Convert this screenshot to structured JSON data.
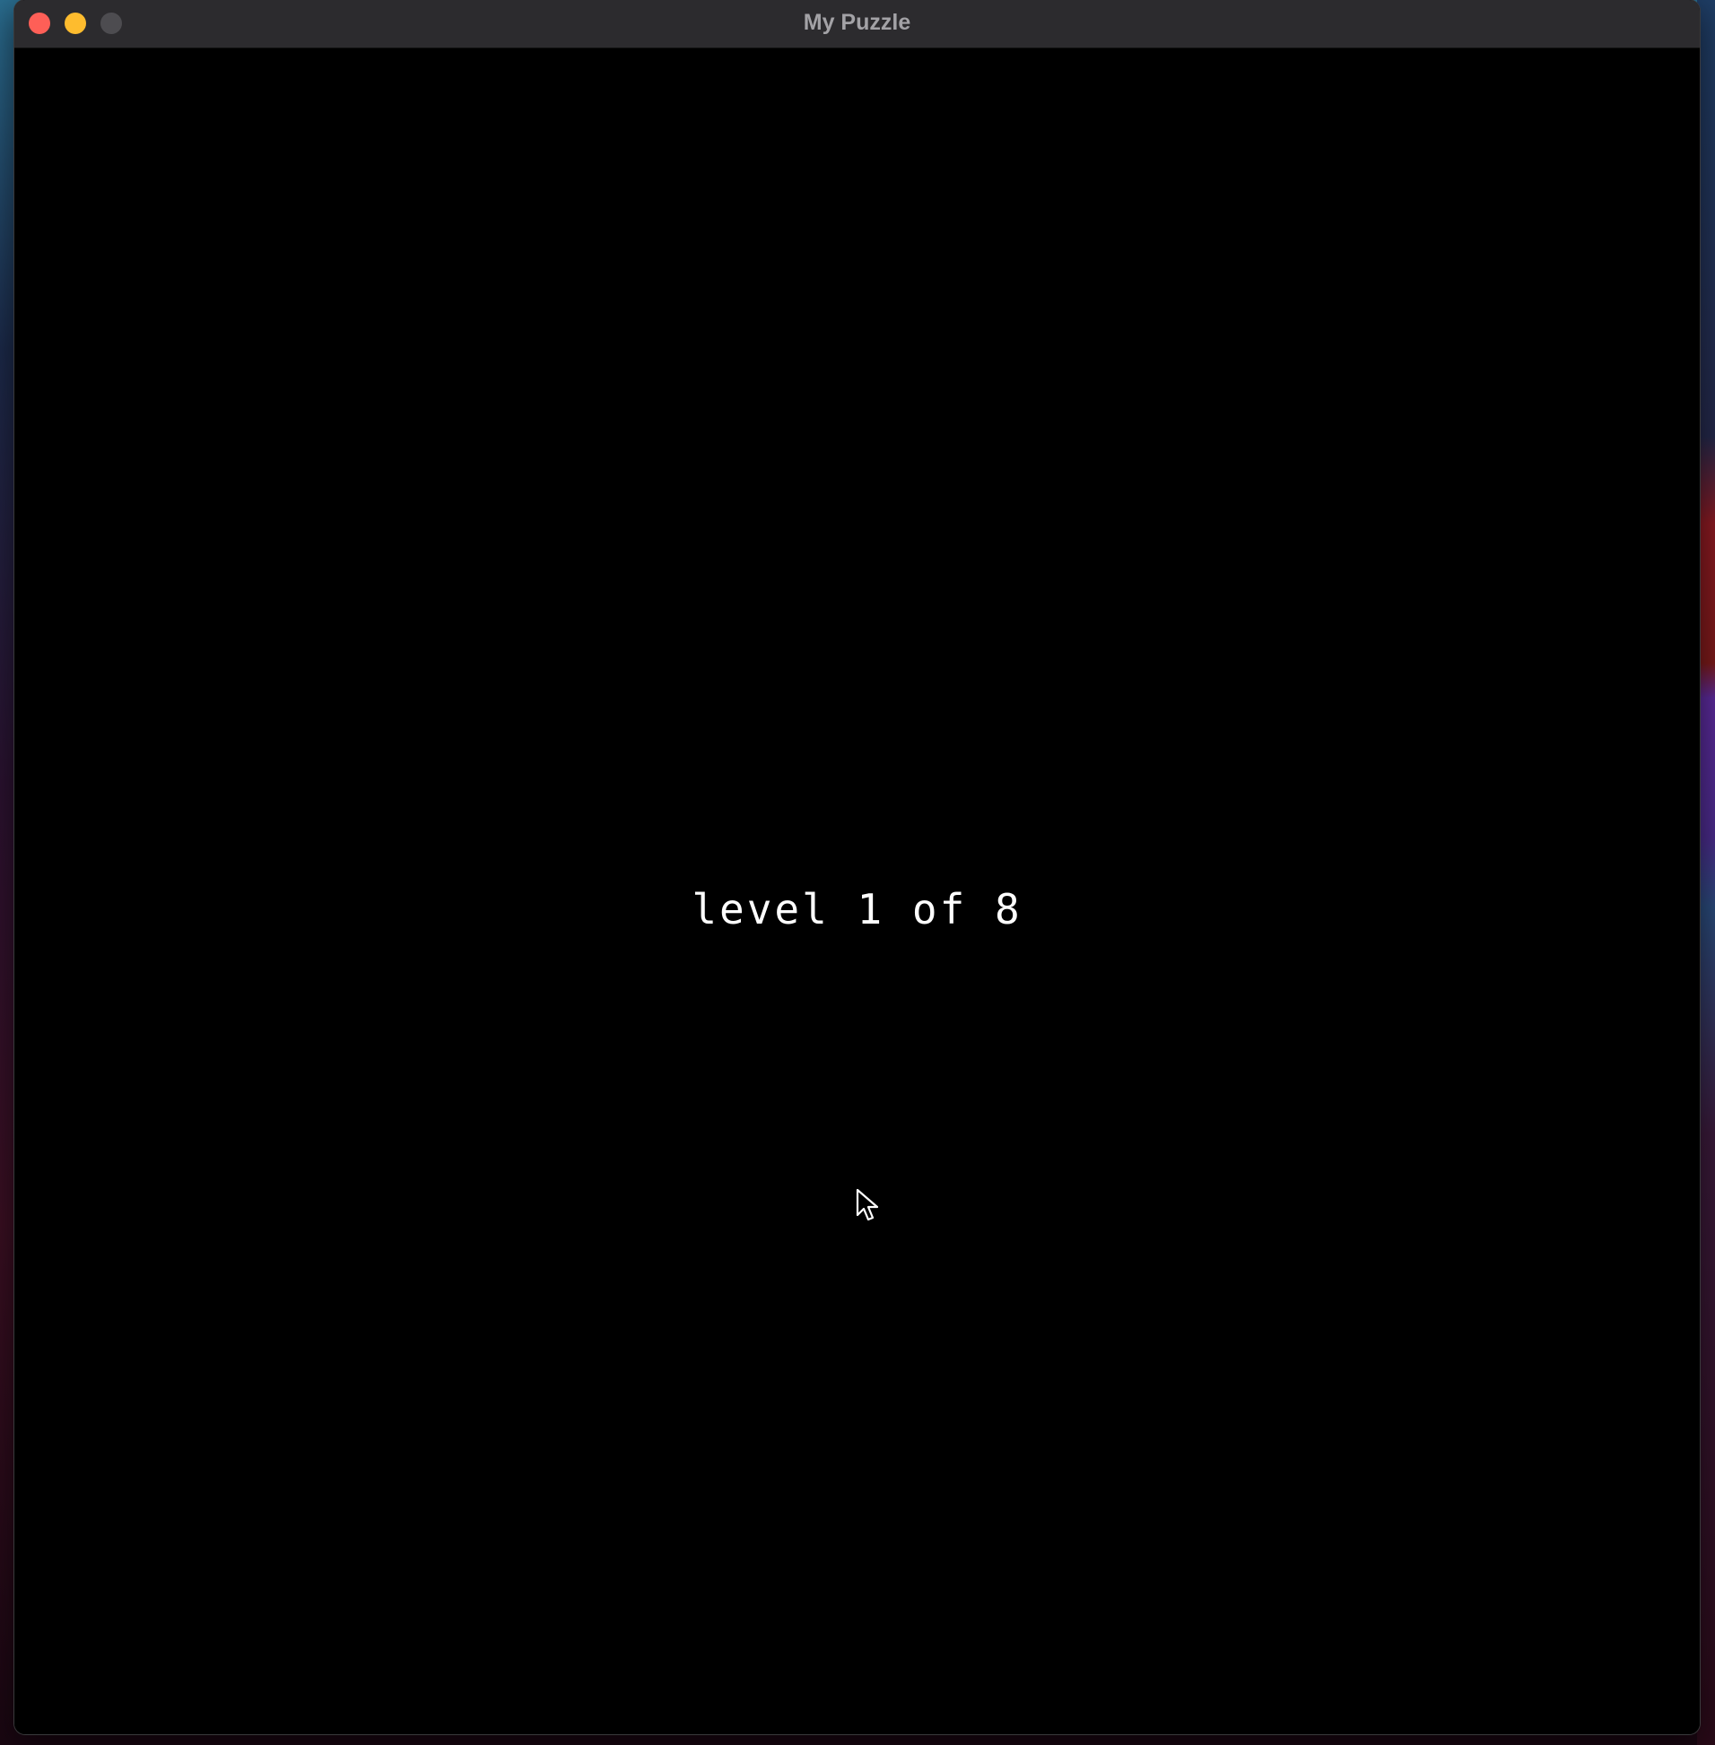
{
  "window": {
    "title": "My Puzzle"
  },
  "game": {
    "level_text": "level 1 of 8"
  },
  "icons": {
    "close": "close-traffic-light-icon",
    "minimize": "minimize-traffic-light-icon",
    "maximize": "maximize-traffic-light-icon",
    "cursor": "mouse-pointer-icon"
  },
  "colors": {
    "titlebar": "#2c2b2e",
    "close": "#fe5f57",
    "minimize": "#febc2e",
    "maximize_disabled": "#4d4c50",
    "game_background": "#000000",
    "text": "#ffffff"
  }
}
